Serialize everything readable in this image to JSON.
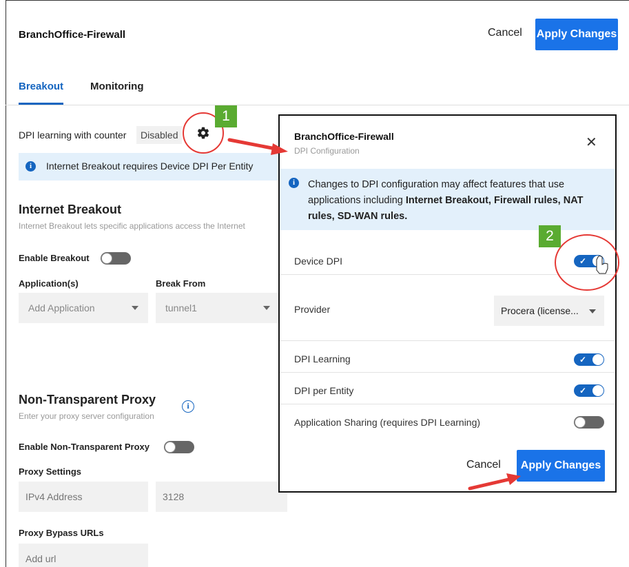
{
  "header": {
    "title": "BranchOffice-Firewall",
    "cancel_label": "Cancel",
    "apply_label": "Apply Changes"
  },
  "tabs": [
    {
      "label": "Breakout",
      "active": true
    },
    {
      "label": "Monitoring",
      "active": false
    }
  ],
  "dpi": {
    "label": "DPI learning with counter",
    "status": "Disabled",
    "icon": "gear-icon"
  },
  "breakout_banner": "Internet Breakout requires Device DPI Per Entity",
  "internet_breakout": {
    "title": "Internet Breakout",
    "subtitle": "Internet Breakout lets specific applications access the Internet",
    "enable_label": "Enable Breakout",
    "enabled": false,
    "applications_label": "Application(s)",
    "break_from_label": "Break From",
    "application_placeholder": "Add Application",
    "break_from_value": "tunnel1"
  },
  "proxy": {
    "title": "Non-Transparent Proxy",
    "subtitle": "Enter your proxy server configuration",
    "enable_label": "Enable Non-Transparent Proxy",
    "enabled": false,
    "settings_label": "Proxy Settings",
    "ip_placeholder": "IPv4 Address",
    "port_placeholder": "3128",
    "bypass_label": "Proxy Bypass URLs",
    "bypass_placeholder": "Add url"
  },
  "modal": {
    "title": "BranchOffice-Firewall",
    "subtitle": "DPI Configuration",
    "close_icon": "close-icon",
    "banner_prefix": "Changes to DPI configuration may affect features that use applications including ",
    "banner_bold": "Internet Breakout, Firewall rules, NAT rules, SD-WAN rules.",
    "rows": {
      "device_dpi": {
        "label": "Device DPI",
        "enabled": true
      },
      "provider": {
        "label": "Provider",
        "value": "Procera (license..."
      },
      "dpi_learning": {
        "label": "DPI Learning",
        "enabled": true
      },
      "dpi_per_entity": {
        "label": "DPI per Entity",
        "enabled": true
      },
      "app_sharing": {
        "label": "Application Sharing (requires DPI Learning)",
        "enabled": false
      }
    },
    "cancel_label": "Cancel",
    "apply_label": "Apply Changes"
  },
  "annotations": {
    "step1": "1",
    "step2": "2",
    "accent_red": "#e53935",
    "accent_green": "#5aab31"
  },
  "colors": {
    "primary": "#1a73e8",
    "tab_active": "#1565c0",
    "banner_bg": "#e3f0fb"
  }
}
